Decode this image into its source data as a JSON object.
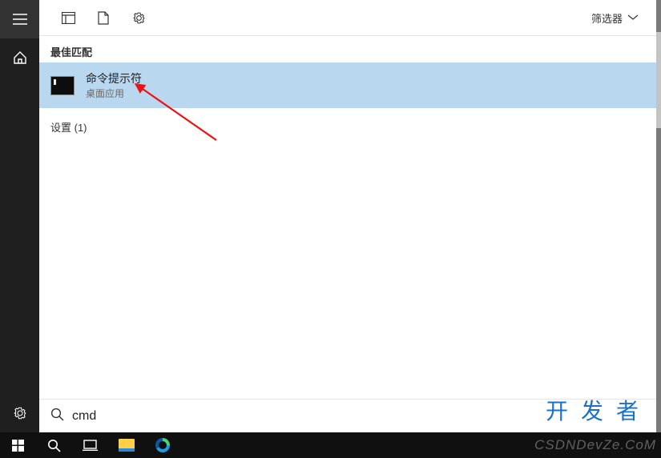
{
  "leftRail": {
    "menu": "menu",
    "home": "home",
    "settings": "settings"
  },
  "topbar": {
    "apps": "apps",
    "documents": "documents",
    "settings": "settings",
    "filterLabel": "筛选器"
  },
  "sections": {
    "bestMatch": "最佳匹配",
    "settings": "设置 (1)"
  },
  "result": {
    "title": "命令提示符",
    "subtitle": "桌面应用"
  },
  "search": {
    "value": "cmd",
    "placeholder": ""
  },
  "taskbar": {
    "start": "start",
    "search": "search",
    "taskview": "taskview",
    "explorer": "explorer",
    "edge": "edge"
  },
  "watermarks": {
    "w1": "开发者",
    "w2": "CSDNDevZe.CoM"
  }
}
